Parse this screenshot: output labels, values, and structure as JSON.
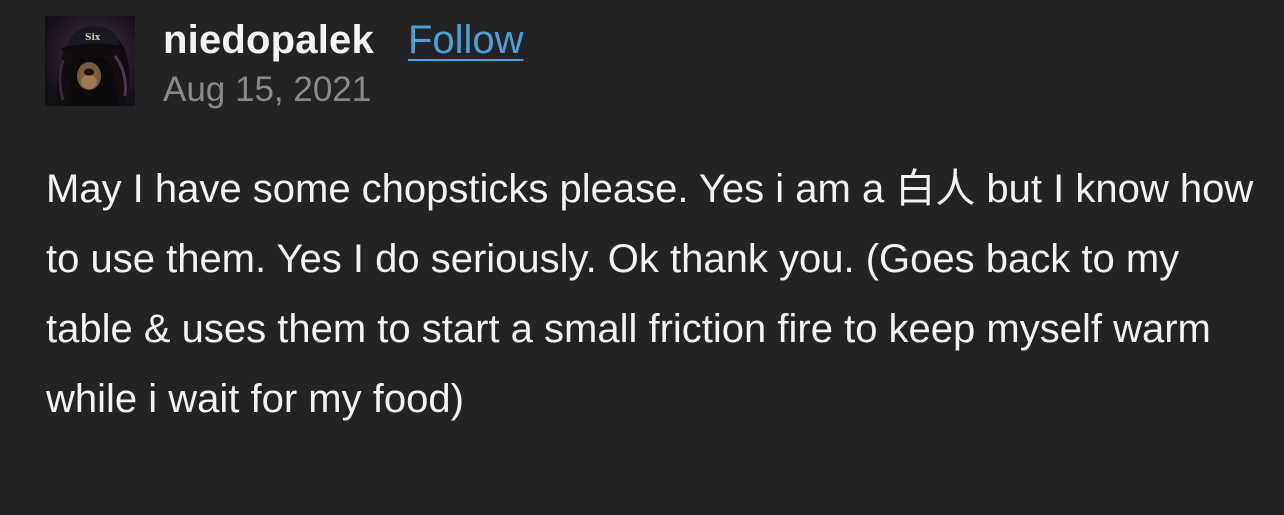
{
  "post": {
    "author": {
      "username": "niedopalek",
      "avatar_icon": "avatar-image",
      "follow_label": "Follow",
      "follow_color": "#4d9fd9"
    },
    "date": "Aug 15, 2021",
    "body": "May I have some chopsticks please. Yes i am a 白人 but I know how to use them. Yes I do seriously. Ok thank you. (Goes back to my table & uses them to start a small friction fire to keep myself warm while i wait for my food)"
  },
  "colors": {
    "background": "#232323",
    "text": "#f3f3f3",
    "muted": "#8a8a8a",
    "link": "#4d9fd9"
  }
}
